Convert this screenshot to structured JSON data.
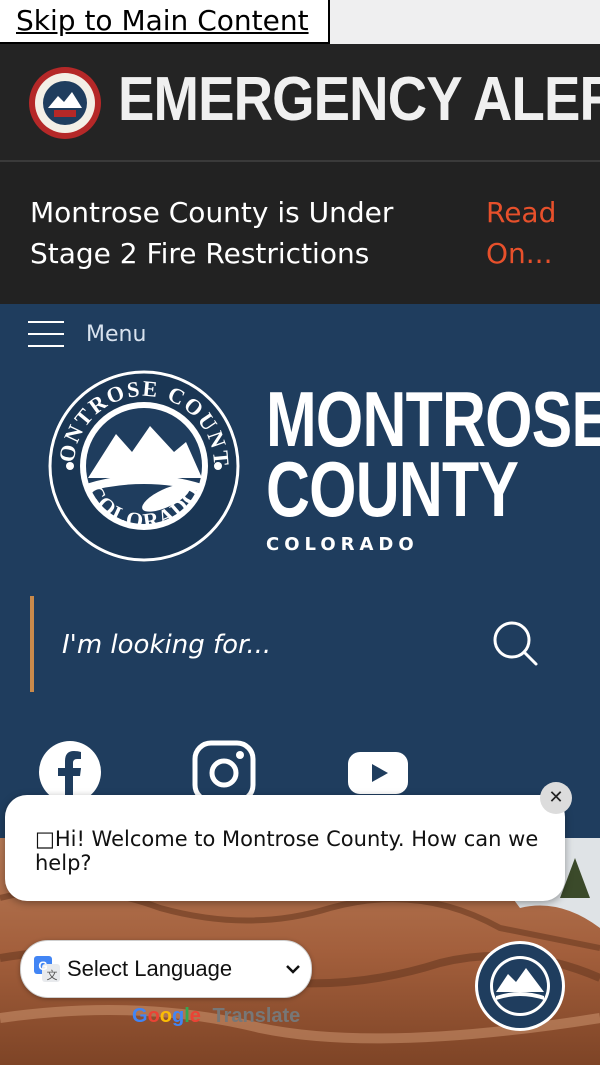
{
  "skip": {
    "label": "Skip to Main Content"
  },
  "alert": {
    "title": "EMERGENCY ALERT",
    "message": "Montrose County is Under Stage 2 Fire Restrictions",
    "link": "Read On...",
    "link_color": "#e7502b"
  },
  "nav": {
    "menu_label": "Menu"
  },
  "brand": {
    "line1": "MONTROSE",
    "line2": "COUNTY",
    "sub": "COLORADO",
    "seal_top_text": "MONTROSE COUNTY",
    "seal_bottom_text": "COLORADO"
  },
  "search": {
    "placeholder": "I'm looking for..."
  },
  "social": [
    "facebook-icon",
    "instagram-icon",
    "youtube-icon"
  ],
  "chat": {
    "message": "□Hi! Welcome to Montrose County. How can we help?",
    "close_glyph": "✕"
  },
  "translate": {
    "select_label": "Select Language",
    "powered_by": "Translate"
  },
  "colors": {
    "header_bg": "#1f3d5e",
    "alert_bg": "#242424",
    "accent": "#c98a4b"
  }
}
